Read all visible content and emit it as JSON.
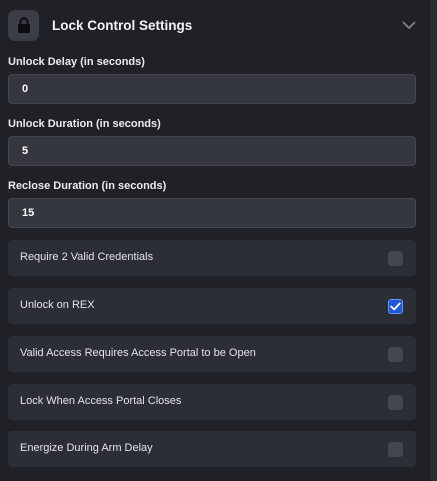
{
  "header": {
    "title": "Lock Control Settings",
    "icon": "lock-icon",
    "toggle_icon": "chevron-down-icon"
  },
  "fields": [
    {
      "label": "Unlock Delay (in seconds)",
      "value": "0"
    },
    {
      "label": "Unlock Duration (in seconds)",
      "value": "5"
    },
    {
      "label": "Reclose Duration (in seconds)",
      "value": "15"
    }
  ],
  "options": [
    {
      "label": "Require 2 Valid Credentials",
      "checked": false
    },
    {
      "label": "Unlock on REX",
      "checked": true
    },
    {
      "label": "Valid Access Requires Access Portal to be Open",
      "checked": false
    },
    {
      "label": "Lock When Access Portal Closes",
      "checked": false
    },
    {
      "label": "Energize During Arm Delay",
      "checked": false
    }
  ],
  "colors": {
    "background": "#1f2126",
    "input_bg": "#34373d",
    "row_bg": "#2b2e34",
    "accent": "#1f57d6"
  }
}
